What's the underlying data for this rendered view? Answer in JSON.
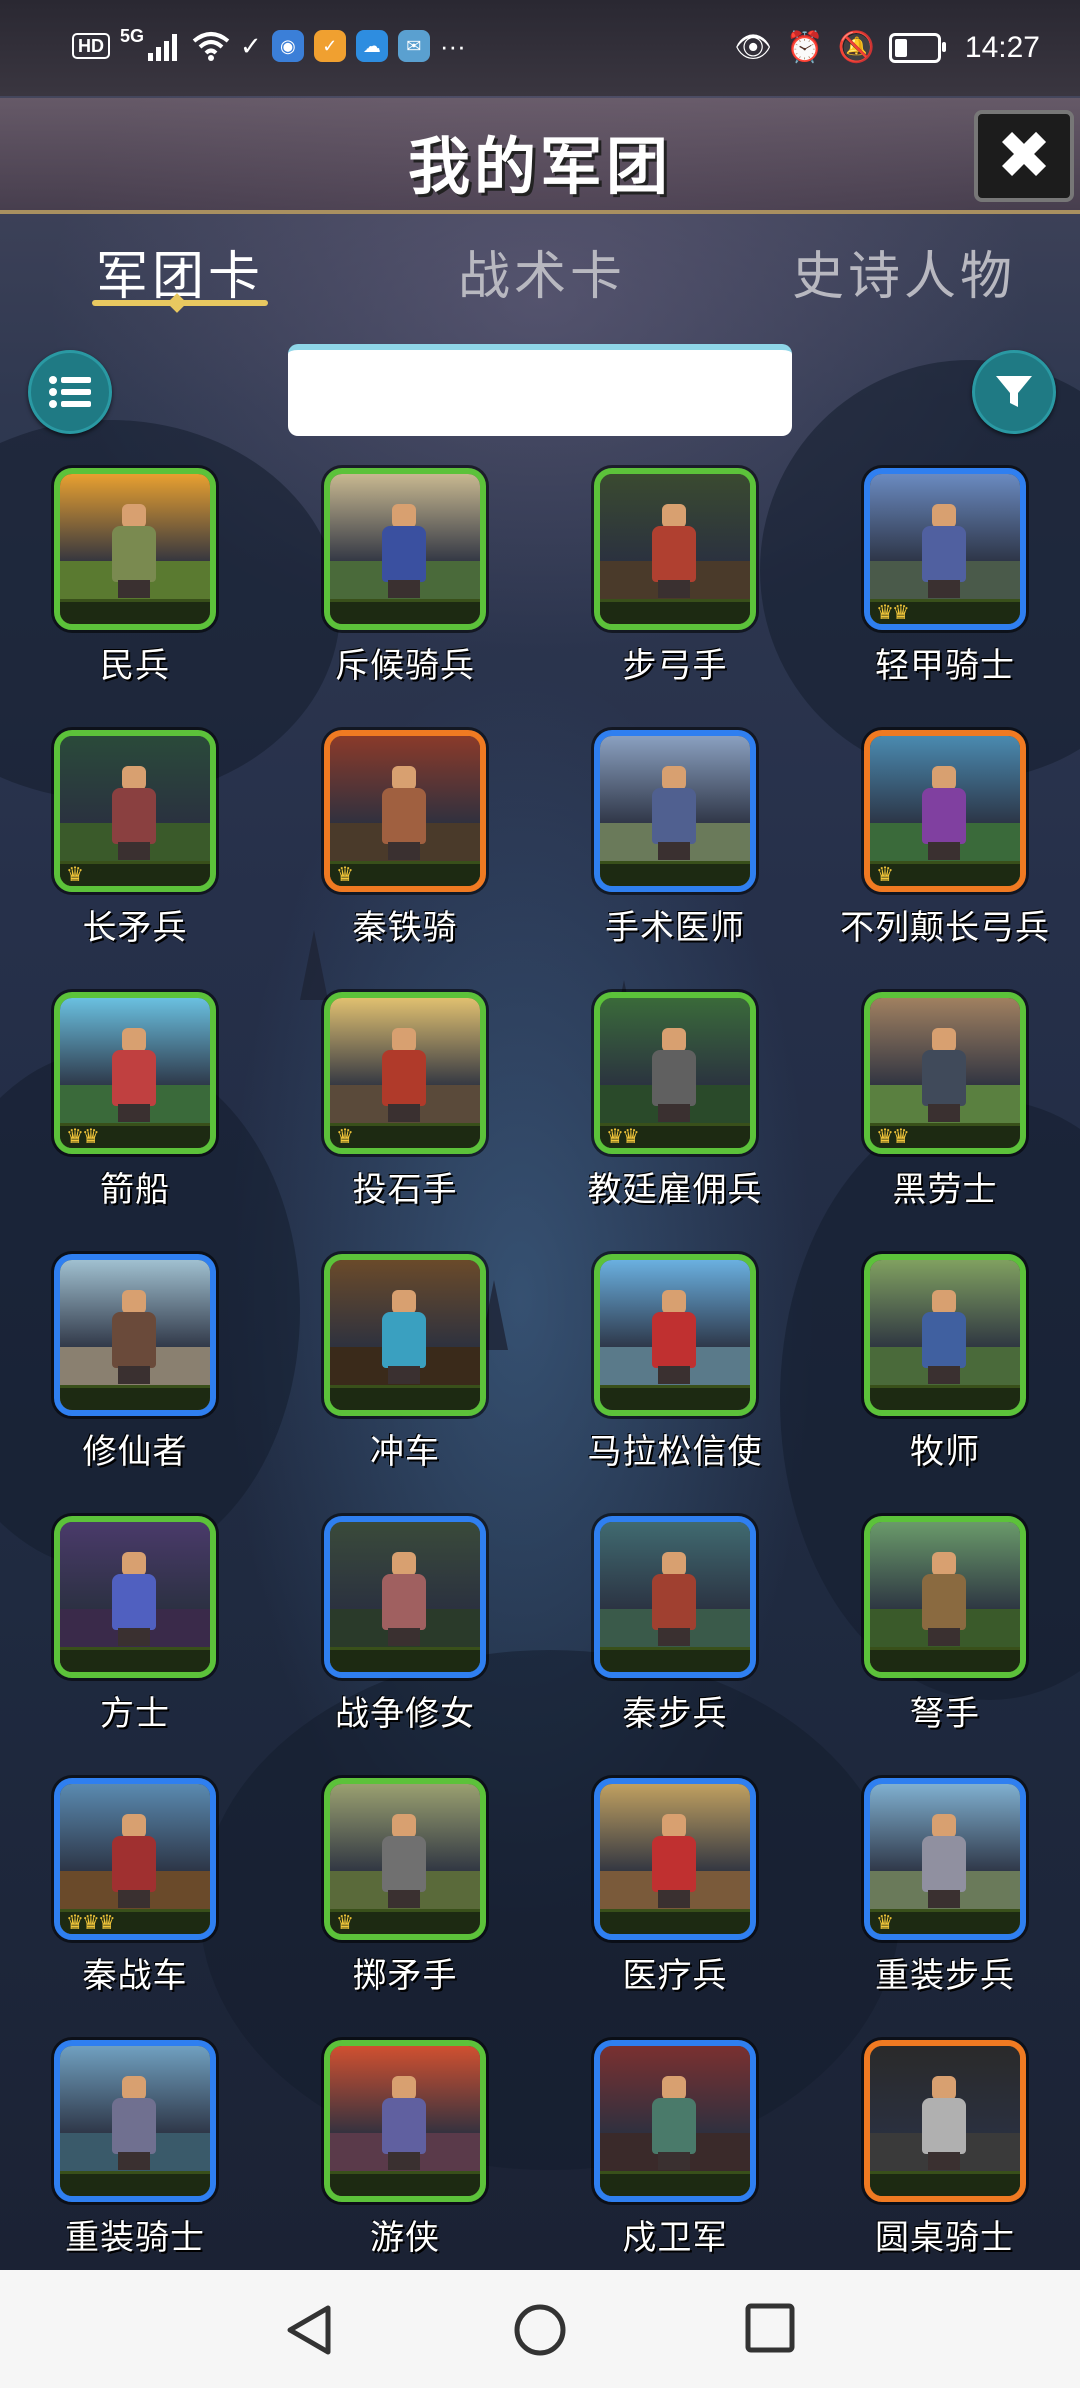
{
  "status_bar": {
    "left_indicators": [
      "HD",
      "5G"
    ],
    "time": "14:27"
  },
  "header": {
    "title": "我的军团",
    "close_label": "✖"
  },
  "tabs": [
    {
      "label": "军团卡",
      "active": true
    },
    {
      "label": "战术卡",
      "active": false
    },
    {
      "label": "史诗人物",
      "active": false
    }
  ],
  "toolbar": {
    "list_icon": "list-icon",
    "filter_icon": "filter-icon",
    "search_value": ""
  },
  "units": [
    {
      "name": "民兵",
      "rarity": "green",
      "crowns": 0
    },
    {
      "name": "斥候骑兵",
      "rarity": "green",
      "crowns": 0
    },
    {
      "name": "步弓手",
      "rarity": "green",
      "crowns": 0
    },
    {
      "name": "轻甲骑士",
      "rarity": "blue",
      "crowns": 2
    },
    {
      "name": "长矛兵",
      "rarity": "green",
      "crowns": 1
    },
    {
      "name": "秦铁骑",
      "rarity": "orange",
      "crowns": 1
    },
    {
      "name": "手术医师",
      "rarity": "blue",
      "crowns": 0
    },
    {
      "name": "不列颠长弓兵",
      "rarity": "orange",
      "crowns": 1
    },
    {
      "name": "箭船",
      "rarity": "green",
      "crowns": 2
    },
    {
      "name": "投石手",
      "rarity": "green",
      "crowns": 1
    },
    {
      "name": "教廷雇佣兵",
      "rarity": "green",
      "crowns": 2
    },
    {
      "name": "黑劳士",
      "rarity": "green",
      "crowns": 2
    },
    {
      "name": "修仙者",
      "rarity": "blue",
      "crowns": 0
    },
    {
      "name": "冲车",
      "rarity": "green",
      "crowns": 0
    },
    {
      "name": "马拉松信使",
      "rarity": "green",
      "crowns": 0
    },
    {
      "name": "牧师",
      "rarity": "green",
      "crowns": 0
    },
    {
      "name": "方士",
      "rarity": "green",
      "crowns": 0
    },
    {
      "name": "战争修女",
      "rarity": "blue",
      "crowns": 0
    },
    {
      "name": "秦步兵",
      "rarity": "blue",
      "crowns": 0
    },
    {
      "name": "弩手",
      "rarity": "green",
      "crowns": 0
    },
    {
      "name": "秦战车",
      "rarity": "blue",
      "crowns": 3
    },
    {
      "name": "掷矛手",
      "rarity": "green",
      "crowns": 1
    },
    {
      "name": "医疗兵",
      "rarity": "blue",
      "crowns": 0
    },
    {
      "name": "重装步兵",
      "rarity": "blue",
      "crowns": 1
    },
    {
      "name": "重装骑士",
      "rarity": "blue",
      "crowns": 0
    },
    {
      "name": "游侠",
      "rarity": "green",
      "crowns": 0
    },
    {
      "name": "戍卫军",
      "rarity": "blue",
      "crowns": 0
    },
    {
      "name": "圆桌骑士",
      "rarity": "orange",
      "crowns": 0
    }
  ],
  "colors": {
    "green": "#5cc23a",
    "blue": "#2f7ff0",
    "orange": "#f07a22",
    "accent_gold": "#e8c860",
    "button_teal": "#1f7a84"
  },
  "nav_bar": {
    "back_icon": "back-triangle-icon",
    "home_icon": "home-circle-icon",
    "recents_icon": "recents-square-icon"
  }
}
